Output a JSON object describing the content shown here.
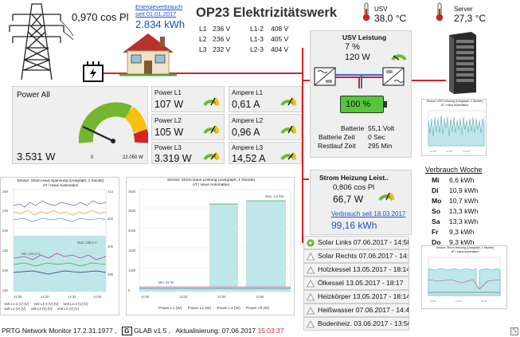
{
  "header": {
    "cos_phi_value": "0,970 cos Pl",
    "energy_link": "Energieverbrauch seit 01.01.2017",
    "energy_value": "2.834 kWh",
    "title": "OP23 Elektrizitätswerk",
    "phases_left": [
      {
        "label": "L1",
        "value": "236 V"
      },
      {
        "label": "L2",
        "value": "236 V"
      },
      {
        "label": "L3",
        "value": "232 V"
      }
    ],
    "phases_right": [
      {
        "label": "L1-2",
        "value": "408 V"
      },
      {
        "label": "L1-3",
        "value": "405 V"
      },
      {
        "label": "L2-3",
        "value": "404 V"
      }
    ],
    "usv_label": "USV",
    "usv_temp": "38,0 °C",
    "server_label": "Server",
    "server_temp": "27,3 °C"
  },
  "power_all": {
    "label": "Power All",
    "value": "3.531 W",
    "gauge_min": "0",
    "gauge_max": "22.050 W",
    "gauge_fraction": 0.16
  },
  "power_tiles": [
    {
      "label": "Power L1",
      "value": "107 W"
    },
    {
      "label": "Power L2",
      "value": "105 W"
    },
    {
      "label": "Power L3",
      "value": "3.319 W"
    }
  ],
  "ampere_tiles": [
    {
      "label": "Ampere L1",
      "value": "0,61 A"
    },
    {
      "label": "Ampere L2",
      "value": "0,96 A"
    },
    {
      "label": "Ampere L3",
      "value": "14,52 A"
    }
  ],
  "usv_panel": {
    "title": "USV Leistung",
    "percent": "7 %",
    "watts": "120 W",
    "battery_percent": "100 %",
    "rows": [
      {
        "k": "Batterie",
        "v": "55,1 Volt"
      },
      {
        "k": "Batterie Zeit",
        "v": "0 Sec"
      },
      {
        "k": "Restlauf Zeit",
        "v": "295 Min"
      }
    ]
  },
  "heating_panel": {
    "title": "Strom Heizung Leist..",
    "cos": "0,806 cos Pl",
    "watts": "66,7 W",
    "link": "Verbrauch seit 18.03.2017",
    "kwh": "99,16 kWh"
  },
  "alarms": [
    {
      "label": "Solar Links 07.06.2017 - 14:58",
      "state": "ok"
    },
    {
      "label": "Solar Rechts 07.06.2017 - 14:58",
      "state": "warn"
    },
    {
      "label": "Holzkessel 13.05.2017 - 18:14",
      "state": "warn"
    },
    {
      "label": "Ölkessel 13.05.2017 - 18:17",
      "state": "warn"
    },
    {
      "label": "Heizkörper 13.05.2017 - 18:14",
      "state": "warn"
    },
    {
      "label": "Heißwasser 07.06.2017 - 14:45",
      "state": "warn"
    },
    {
      "label": "Bodenheiz. 03.06.2017 - 13:56",
      "state": "warn"
    }
  ],
  "weekly": {
    "title": "Verbrauch Woche",
    "rows": [
      {
        "day": "Mi",
        "value": "6,6 kWh"
      },
      {
        "day": "Di",
        "value": "10,9 kWh"
      },
      {
        "day": "Mo",
        "value": "10,7 kWh"
      },
      {
        "day": "So",
        "value": "13,3 kWh"
      },
      {
        "day": "Sa",
        "value": "13,3 kWh"
      },
      {
        "day": "Fr",
        "value": "9,3 kWh"
      },
      {
        "day": "Do",
        "value": "9,3 kWh"
      }
    ]
  },
  "charts": {
    "voltage_title": "Sensor: Strom Haus Spannung (Livegraph, 1 Stunde)",
    "voltage_subtitle": "AT / Haus Automation",
    "voltage_legend": [
      "Volt L1-2 (V) [V]",
      "Volt L1-3 (V) [V]",
      "Volt L2-3 (V) [V]",
      "Volt L1 (V) [V]",
      "Volt L2 (V) [V]",
      "Volt L3 (V) [V]"
    ],
    "power_title": "Sensor: Strom Haus Leistung (Livegraph, 1 Stunde)",
    "power_subtitle": "AT / Haus Automation",
    "power_legend": [
      "Power L1 (W)",
      "Power L2 (W)",
      "Power L3 (W)",
      "Power All (W)"
    ],
    "usv_mini_title": "Sensor: USV Leistung (Livegraph, 1 Stunde)",
    "usv_mini_subtitle": "AT / Haus Automation",
    "heating_mini_title": "Sensor: Strom Heizung (Livegraph, 1 Stunde)",
    "heating_mini_subtitle": "AT / Haus Automation"
  },
  "footer": {
    "product": "PRTG Network Monitor 17.2.31.1977 ,",
    "glab": "GLAB v1.5 ,",
    "update_label": "Aktualisierung:",
    "update_date": "07.06.2017",
    "update_time": "15:03:37"
  },
  "colors": {
    "accent_blue": "#1a4fd6",
    "alarm_red": "#d52222",
    "gauge_green": "#74b62f",
    "battery_green": "#55c63a",
    "chart_fill": "#bfe6e8"
  }
}
